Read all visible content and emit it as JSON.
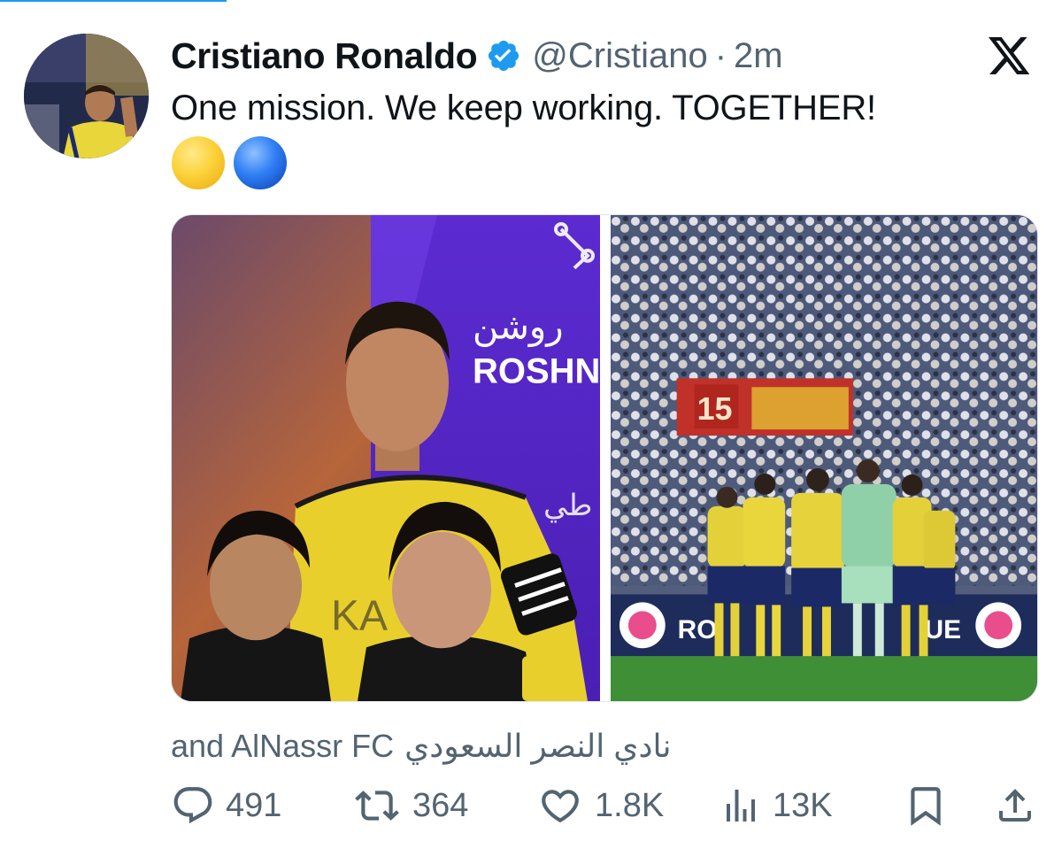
{
  "tweet": {
    "author_name": "Cristiano Ronaldo",
    "handle": "@Cristiano",
    "separator": "·",
    "time": "2m",
    "text": "One mission. We keep working. TOGETHER!",
    "emojis": [
      "yellow-circle",
      "blue-circle"
    ]
  },
  "media": {
    "left_photo": {
      "sponsor_arabic": "روشن",
      "sponsor_latin": "ROSHN",
      "jersey_print": "KA"
    },
    "right_photo": {
      "banner_number": "15",
      "board_text": "RO",
      "board_text_2": "UE"
    }
  },
  "tagged": {
    "prefix": "and AlNassr FC",
    "arabic_name": "نادي النصر السعودي"
  },
  "actions": {
    "replies": "491",
    "reposts": "364",
    "likes": "1.8K",
    "views": "13K"
  },
  "colors": {
    "accent": "#1d9bf0",
    "text": "#0f1419",
    "muted": "#536471",
    "verified": "#1d9bf0"
  },
  "icons": {
    "brand": "x-logo-icon",
    "verified": "verified-badge-icon",
    "reply": "reply-icon",
    "repost": "repost-icon",
    "like": "like-icon",
    "views": "views-icon",
    "bookmark": "bookmark-icon",
    "share": "share-icon"
  }
}
